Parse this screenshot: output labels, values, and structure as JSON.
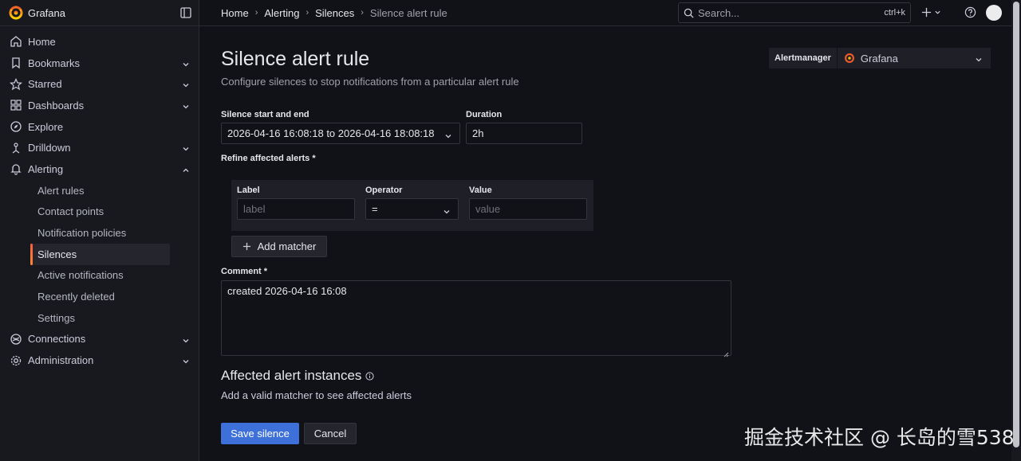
{
  "brand": {
    "name": "Grafana"
  },
  "nav": {
    "items": [
      {
        "label": "Home",
        "icon": "home-icon"
      },
      {
        "label": "Bookmarks",
        "icon": "bookmark-icon"
      },
      {
        "label": "Starred",
        "icon": "star-icon"
      },
      {
        "label": "Dashboards",
        "icon": "dashboards-icon"
      },
      {
        "label": "Explore",
        "icon": "compass-icon"
      },
      {
        "label": "Drilldown",
        "icon": "drilldown-icon"
      },
      {
        "label": "Alerting",
        "icon": "bell-icon"
      }
    ],
    "alerting_sub": [
      "Alert rules",
      "Contact points",
      "Notification policies",
      "Silences",
      "Active notifications",
      "Recently deleted",
      "Settings"
    ],
    "bottom": [
      {
        "label": "Connections",
        "icon": "connections-icon"
      },
      {
        "label": "Administration",
        "icon": "gear-icon"
      }
    ]
  },
  "breadcrumbs": [
    "Home",
    "Alerting",
    "Silences",
    "Silence alert rule"
  ],
  "search": {
    "placeholder": "Search...",
    "shortcut": "ctrl+k"
  },
  "page": {
    "title": "Silence alert rule",
    "subtitle": "Configure silences to stop notifications from a particular alert rule"
  },
  "alertmanager": {
    "label": "Alertmanager",
    "value": "Grafana"
  },
  "form": {
    "start_end_label": "Silence start and end",
    "start_end_value": "2026-04-16 16:08:18 to 2026-04-16 18:08:18",
    "duration_label": "Duration",
    "duration_value": "2h",
    "refine_label": "Refine affected alerts *",
    "matcher": {
      "label_header": "Label",
      "operator_header": "Operator",
      "value_header": "Value",
      "label_placeholder": "label",
      "operator_value": "=",
      "value_placeholder": "value"
    },
    "add_matcher": "Add matcher",
    "comment_label": "Comment *",
    "comment_value": "created 2026-04-16 16:08"
  },
  "affected": {
    "title": "Affected alert instances",
    "note": "Add a valid matcher to see affected alerts"
  },
  "actions": {
    "save": "Save silence",
    "cancel": "Cancel"
  },
  "watermark": "掘金技术社区 @ 长岛的雪538",
  "colors": {
    "primary": "#3d71d9",
    "accent": "#f55f3e",
    "background": "#111217",
    "sidebar": "#18191f"
  }
}
